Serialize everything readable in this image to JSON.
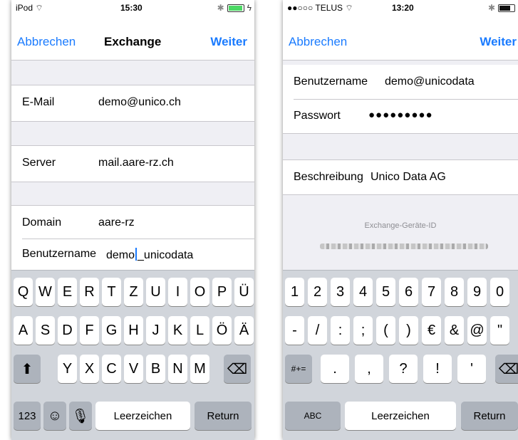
{
  "left": {
    "status": {
      "carrier": "iPod",
      "time": "15:30"
    },
    "nav": {
      "cancel": "Abbrechen",
      "title": "Exchange",
      "next": "Weiter"
    },
    "fields": {
      "email": {
        "label": "E-Mail",
        "value": "demo@unico.ch"
      },
      "server": {
        "label": "Server",
        "value": "mail.aare-rz.ch"
      },
      "domain": {
        "label": "Domain",
        "value": "aare-rz"
      },
      "username": {
        "label": "Benutzername",
        "value_before_cursor": "demo",
        "value_after_cursor": "_unicodata"
      }
    },
    "keyboard": {
      "row1": [
        "Q",
        "W",
        "E",
        "R",
        "T",
        "Z",
        "U",
        "I",
        "O",
        "P",
        "Ü"
      ],
      "row2": [
        "A",
        "S",
        "D",
        "F",
        "G",
        "H",
        "J",
        "K",
        "L",
        "Ö",
        "Ä"
      ],
      "row3": [
        "Y",
        "X",
        "C",
        "V",
        "B",
        "N",
        "M"
      ],
      "numbers_key": "123",
      "space": "Leerzeichen",
      "return": "Return",
      "shift_icon": "shift-icon",
      "delete_icon": "delete-icon",
      "emoji_icon": "emoji-icon",
      "mic_icon": "microphone-icon"
    }
  },
  "right": {
    "status": {
      "carrier": "●●○○○ TELUS",
      "time": "13:20"
    },
    "nav": {
      "cancel": "Abbrechen",
      "next": "Weiter"
    },
    "fields": {
      "username": {
        "label": "Benutzername",
        "value": "demo@unicodata"
      },
      "password": {
        "label": "Passwort",
        "value": "●●●●●●●●●"
      },
      "description": {
        "label": "Beschreibung",
        "value": "Unico Data AG"
      }
    },
    "device_id_label": "Exchange-Geräte-ID",
    "keyboard": {
      "row1": [
        "1",
        "2",
        "3",
        "4",
        "5",
        "6",
        "7",
        "8",
        "9",
        "0"
      ],
      "row2": [
        "-",
        "/",
        ":",
        ";",
        "(",
        ")",
        "€",
        "&",
        "@",
        "\""
      ],
      "row3": [
        ".",
        ",",
        "?",
        "!",
        "'"
      ],
      "symbols_key": "#+=",
      "abc_key": "ABC",
      "space": "Leerzeichen",
      "return": "Return"
    }
  },
  "colors": {
    "accent": "#1a7bff",
    "group_bg": "#efeff4",
    "keyboard_bg": "#d1d5db"
  }
}
